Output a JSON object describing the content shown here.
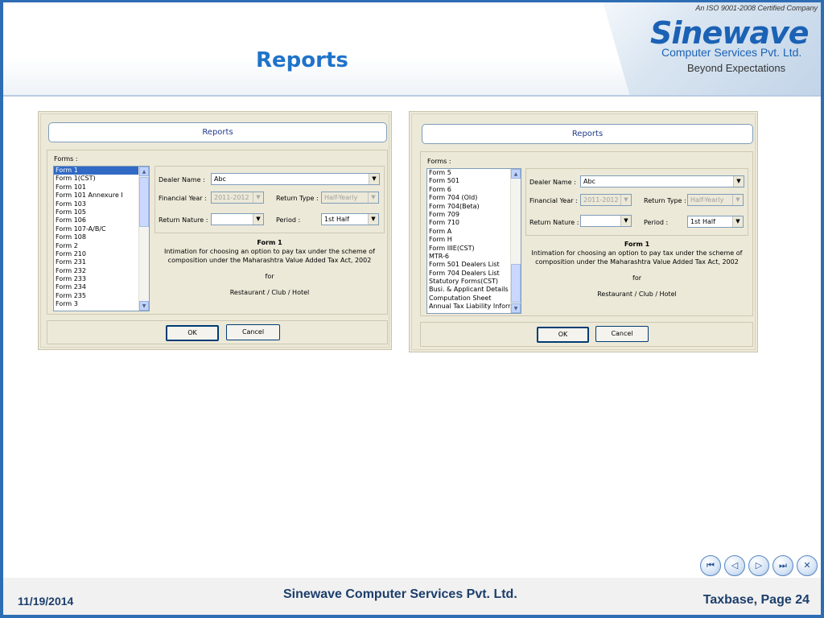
{
  "slide": {
    "title": "Reports",
    "footer_date": "11/19/2014",
    "footer_company": "Sinewave Computer Services Pvt. Ltd.",
    "footer_page": "Taxbase, Page 24"
  },
  "logo": {
    "iso": "An ISO 9001-2008 Certified Company",
    "name": "Sinewave",
    "subtitle": "Computer Services Pvt. Ltd.",
    "tagline": "Beyond Expectations"
  },
  "nav": {
    "first_icon": "⏮",
    "prev_icon": "◁",
    "next_icon": "▷",
    "last_icon": "⏭",
    "close_icon": "✕"
  },
  "dialog_left": {
    "title": "Reports",
    "forms_label": "Forms :",
    "forms_list": [
      "Form 1",
      "Form 1(CST)",
      "Form 101",
      "Form 101 Annexure I",
      "Form 103",
      "Form 105",
      "Form 106",
      "Form 107-A/B/C",
      "Form 108",
      "Form 2",
      "Form 210",
      "Form 231",
      "Form 232",
      "Form 233",
      "Form 234",
      "Form 235",
      "Form 3"
    ],
    "selected_form": "Form 1",
    "dealer_name_label": "Dealer Name :",
    "dealer_name_value": "Abc",
    "financial_year_label": "Financial Year :",
    "financial_year_value": "2011-2012",
    "return_type_label": "Return Type :",
    "return_type_value": "Half-Yearly",
    "return_nature_label": "Return Nature :",
    "return_nature_value": "",
    "period_label": "Period :",
    "period_value": "1st Half",
    "info_title": "Form 1",
    "info_line1": "Intimation for choosing an option to pay tax under the scheme of",
    "info_line2": "composition under the Maharashtra Value Added Tax Act, 2002",
    "info_for": "for",
    "info_category": "Restaurant / Club / Hotel",
    "ok_label": "OK",
    "cancel_label": "Cancel"
  },
  "dialog_right": {
    "title": "Reports",
    "forms_label": "Forms :",
    "forms_list": [
      "Form 5",
      "Form 501",
      "Form 6",
      "Form 704 (Old)",
      "Form 704(Beta)",
      "Form 709",
      "Form 710",
      "Form A",
      "Form H",
      "Form IIIE(CST)",
      "MTR-6",
      "Form 501 Dealers List",
      "Form 704 Dealers List",
      "Statutory Forms(CST)",
      "Busi. & Applicant Details",
      "Computation Sheet",
      "Annual Tax Liability Inform"
    ],
    "dealer_name_label": "Dealer Name :",
    "dealer_name_value": "Abc",
    "financial_year_label": "Financial Year :",
    "financial_year_value": "2011-2012",
    "return_type_label": "Return Type :",
    "return_type_value": "Half-Yearly",
    "return_nature_label": "Return Nature :",
    "return_nature_value": "",
    "period_label": "Period :",
    "period_value": "1st Half",
    "info_title": "Form 1",
    "info_line1": "Intimation for choosing an option to pay tax under the scheme of",
    "info_line2": "composition under the Maharashtra Value Added Tax Act, 2002",
    "info_for": "for",
    "info_category": "Restaurant / Club / Hotel",
    "ok_label": "OK",
    "cancel_label": "Cancel"
  }
}
